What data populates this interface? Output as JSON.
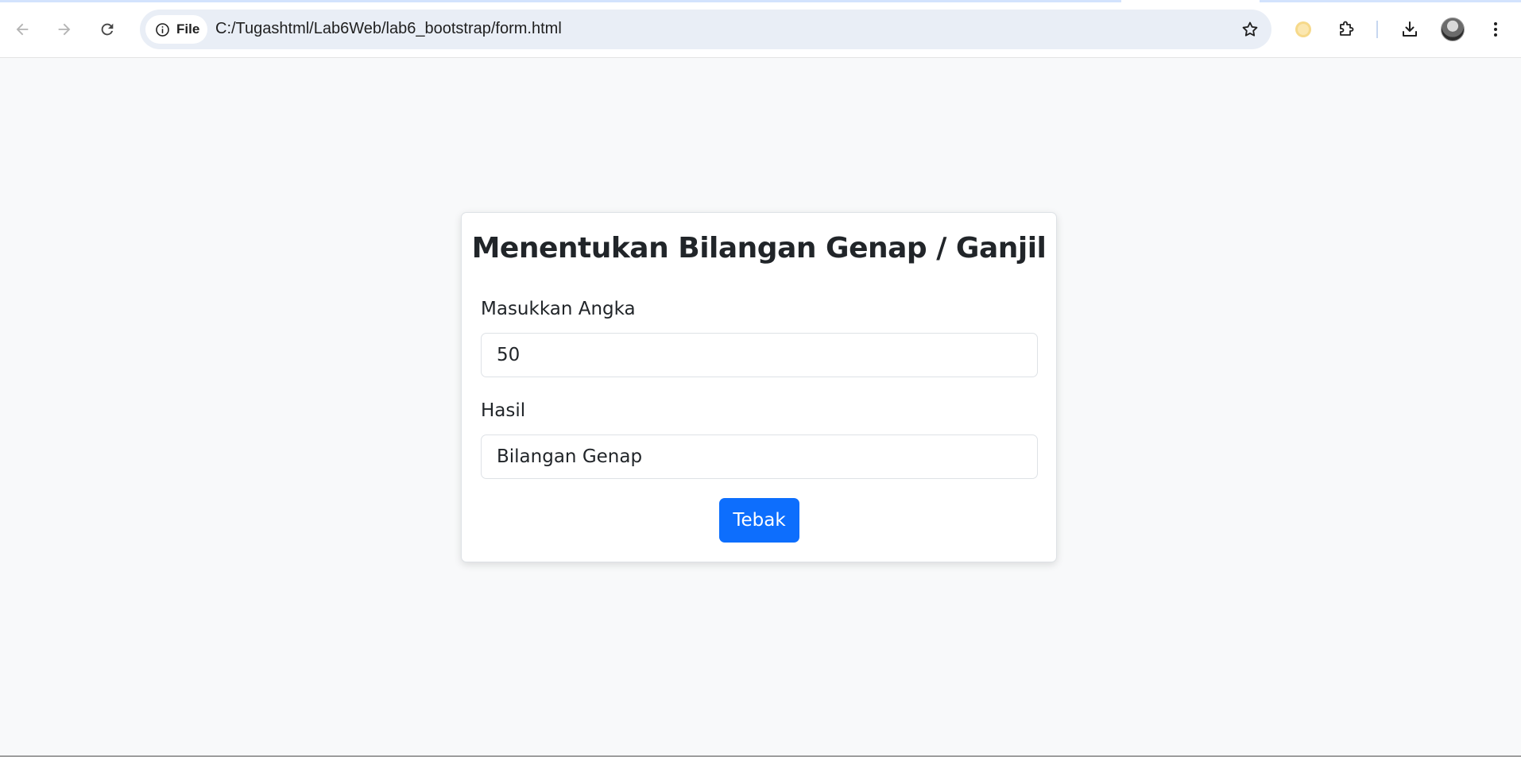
{
  "browser": {
    "site_chip_label": "File",
    "url": "C:/Tugashtml/Lab6Web/lab6_bootstrap/form.html",
    "icons": {
      "back": "arrow-left-icon",
      "forward": "arrow-right-icon",
      "reload": "reload-icon",
      "site_info": "info-icon",
      "bookmark": "star-icon",
      "extension_moon": "moon-icon",
      "extensions": "puzzle-icon",
      "downloads": "download-icon",
      "profile": "avatar",
      "menu": "kebab-menu-icon"
    }
  },
  "page": {
    "title": "Menentukan Bilangan Genap / Ganjil",
    "number_label": "Masukkan Angka",
    "number_value": "50",
    "result_label": "Hasil",
    "result_value": "Bilangan Genap",
    "submit_label": "Tebak"
  },
  "colors": {
    "primary": "#0d6efd",
    "page_background": "#f8f9fa",
    "omnibox_background": "#e9eef6"
  }
}
